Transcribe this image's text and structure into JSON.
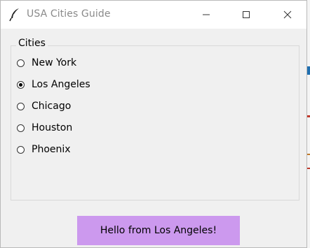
{
  "window": {
    "title": "USA Cities Guide",
    "app_icon": "feather-icon",
    "controls": [
      "minimize-icon",
      "maximize-icon",
      "close-icon"
    ]
  },
  "frame": {
    "label": "Cities",
    "options": [
      {
        "label": "New York",
        "selected": false
      },
      {
        "label": "Los Angeles",
        "selected": true
      },
      {
        "label": "Chicago",
        "selected": false
      },
      {
        "label": "Houston",
        "selected": false
      },
      {
        "label": "Phoenix",
        "selected": false
      }
    ]
  },
  "message": {
    "text": "Hello from Los Angeles!",
    "background": "#cc99ee"
  }
}
